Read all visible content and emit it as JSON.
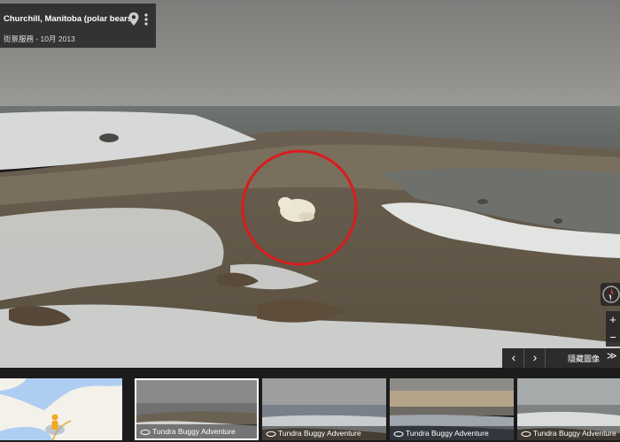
{
  "location": {
    "title": "Churchill, Manitoba (polar bears)",
    "subtitle": "街景服務 - 10月 2013"
  },
  "icons": {
    "pin": "map-pin-icon",
    "more": "more-vert-icon",
    "compass": "compass-icon",
    "collection": "360-panorama-icon"
  },
  "controls": {
    "zoom_in": "+",
    "zoom_out": "−",
    "prev": "‹",
    "next": "›",
    "hide_imagery": "隱藏圖像",
    "collapse": "≫"
  },
  "filmstrip": {
    "items": [
      {
        "label": "Tundra Buggy Adventure"
      },
      {
        "label": "Tundra Buggy Adventure"
      },
      {
        "label": "Tundra Buggy Adventure"
      },
      {
        "label": "Tundra Buggy Adventure"
      }
    ]
  },
  "colors": {
    "highlight_circle": "#d91c1c",
    "pegman": "#f5a623",
    "map_water": "#aecdf2"
  }
}
